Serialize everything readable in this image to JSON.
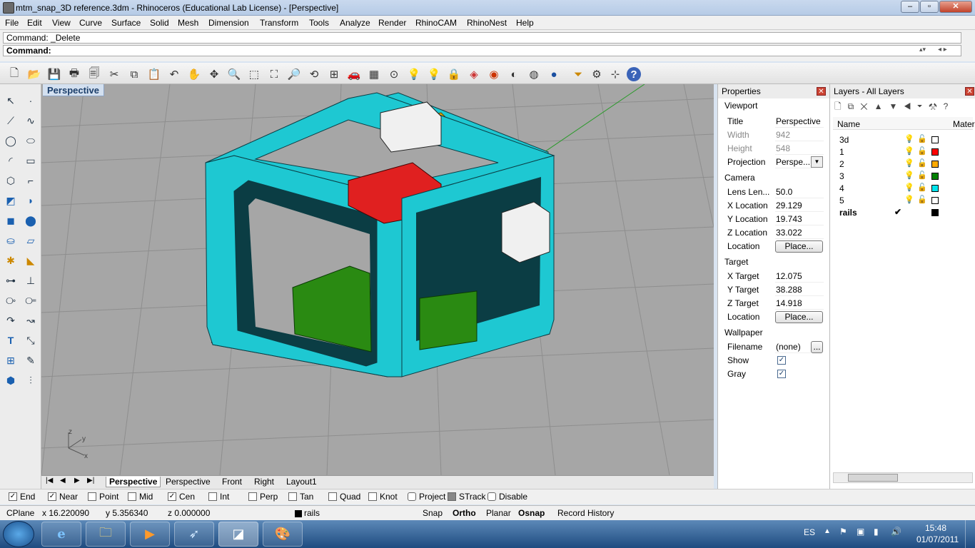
{
  "window": {
    "title": "mtm_snap_3D reference.3dm - Rhinoceros (Educational Lab License) - [Perspective]"
  },
  "menu": [
    "File",
    "Edit",
    "View",
    "Curve",
    "Surface",
    "Solid",
    "Mesh",
    "Dimension",
    "Transform",
    "Tools",
    "Analyze",
    "Render",
    "RhinoCAM",
    "RhinoNest",
    "Help"
  ],
  "command": {
    "history": "Command: _Delete",
    "prompt": "Command:"
  },
  "viewport": {
    "label": "Perspective"
  },
  "viewport_tabs": [
    "Perspective",
    "Perspective",
    "Front",
    "Right",
    "Layout1"
  ],
  "axis": {
    "z": "z",
    "y": "y",
    "x": "x"
  },
  "properties": {
    "header": "Properties",
    "viewport_section": "Viewport",
    "title_label": "Title",
    "title_value": "Perspective",
    "width_label": "Width",
    "width_value": "942",
    "height_label": "Height",
    "height_value": "548",
    "projection_label": "Projection",
    "projection_value": "Perspe...",
    "camera_section": "Camera",
    "lens_label": "Lens Len...",
    "lens_value": "50.0",
    "xloc_label": "X Location",
    "xloc_value": "29.129",
    "yloc_label": "Y Location",
    "yloc_value": "19.743",
    "zloc_label": "Z Location",
    "zloc_value": "33.022",
    "loc_label": "Location",
    "place_button": "Place...",
    "target_section": "Target",
    "xt_label": "X Target",
    "xt_value": "12.075",
    "yt_label": "Y Target",
    "yt_value": "38.288",
    "zt_label": "Z Target",
    "zt_value": "14.918",
    "tloc_label": "Location",
    "tplace_button": "Place...",
    "wallpaper_section": "Wallpaper",
    "filename_label": "Filename",
    "filename_value": "(none)",
    "browse_button": "...",
    "show_label": "Show",
    "gray_label": "Gray"
  },
  "layers": {
    "header": "Layers - All Layers",
    "col_name": "Name",
    "col_material": "Mater",
    "rows": [
      {
        "name": "3d",
        "color": "#ffffff"
      },
      {
        "name": "1",
        "color": "#ff0000"
      },
      {
        "name": "2",
        "color": "#ffaa00"
      },
      {
        "name": "3",
        "color": "#008000"
      },
      {
        "name": "4",
        "color": "#00e5ee"
      },
      {
        "name": "5",
        "color": "#ffffff"
      },
      {
        "name": "rails",
        "color": "#000000",
        "current": "✔"
      }
    ]
  },
  "osnap": [
    {
      "label": "End",
      "checked": true
    },
    {
      "label": "Near",
      "checked": true
    },
    {
      "label": "Point",
      "checked": false
    },
    {
      "label": "Mid",
      "checked": false
    },
    {
      "label": "Cen",
      "checked": true
    },
    {
      "label": "Int",
      "checked": false
    },
    {
      "label": "Perp",
      "checked": false
    },
    {
      "label": "Tan",
      "checked": false
    },
    {
      "label": "Quad",
      "checked": false
    },
    {
      "label": "Knot",
      "checked": false
    },
    {
      "label": "Project",
      "checked": false
    },
    {
      "label": "STrack",
      "checked": false
    },
    {
      "label": "Disable",
      "checked": false
    }
  ],
  "status": {
    "cplane": "CPlane",
    "x": "x 16.220090",
    "y": "y 5.356340",
    "z": "z 0.000000",
    "layer": "rails",
    "snap": "Snap",
    "ortho": "Ortho",
    "planar": "Planar",
    "osnap": "Osnap",
    "history": "Record History"
  },
  "taskbar": {
    "lang": "ES",
    "time": "15:48",
    "date": "01/07/2011"
  },
  "colors": {
    "frame": "#1ec8d2",
    "frame_dark": "#0b3d44",
    "red_part": "#e02020",
    "yellow_part": "#e6a800",
    "green_part": "#2a8a12",
    "viewport_bg": "#a6a6a6"
  }
}
